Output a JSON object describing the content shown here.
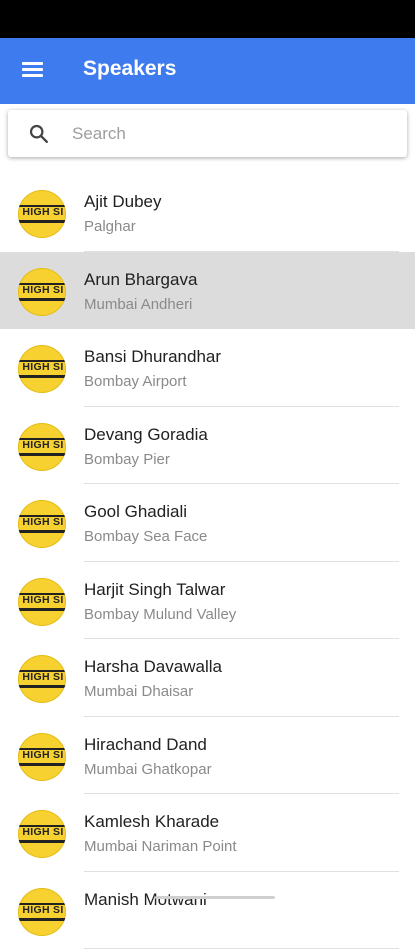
{
  "appbar": {
    "title": "Speakers",
    "menu_icon": "menu-icon"
  },
  "search": {
    "placeholder": "Search",
    "icon": "search-icon"
  },
  "avatar_text": "HIGH SI",
  "speakers": [
    {
      "name": "Ajit Dubey",
      "location": "Palghar",
      "selected": false
    },
    {
      "name": "Arun Bhargava",
      "location": "Mumbai Andheri",
      "selected": true
    },
    {
      "name": "Bansi Dhurandhar",
      "location": "Bombay Airport",
      "selected": false
    },
    {
      "name": "Devang Goradia",
      "location": "Bombay Pier",
      "selected": false
    },
    {
      "name": "Gool Ghadiali",
      "location": "Bombay Sea Face",
      "selected": false
    },
    {
      "name": "Harjit Singh Talwar",
      "location": "Bombay Mulund Valley",
      "selected": false
    },
    {
      "name": "Harsha Davawalla",
      "location": "Mumbai Dhaisar",
      "selected": false
    },
    {
      "name": "Hirachand Dand",
      "location": "Mumbai Ghatkopar",
      "selected": false
    },
    {
      "name": "Kamlesh Kharade",
      "location": "Mumbai Nariman Point",
      "selected": false
    },
    {
      "name": "Manish Motwani",
      "location": "",
      "selected": false
    }
  ],
  "colors": {
    "appbar": "#3d7bee",
    "avatar": "#f7d130",
    "selected_row": "#dcdcdc"
  }
}
